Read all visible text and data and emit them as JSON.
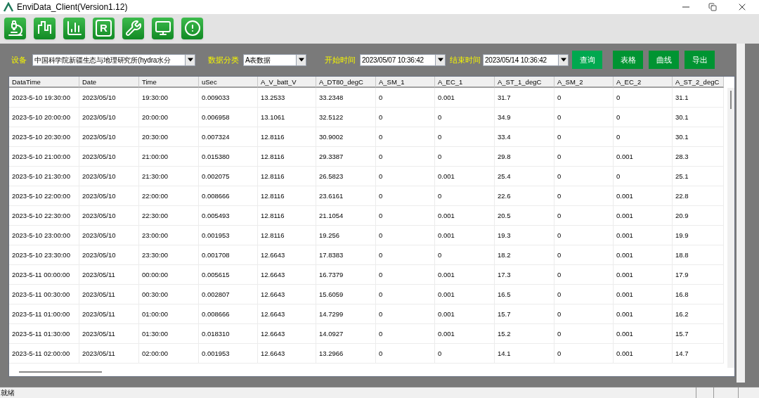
{
  "window": {
    "title": "EnviData_Client(Version1.12)"
  },
  "toolbar": [
    {
      "kind": "microscope"
    },
    {
      "kind": "step-line"
    },
    {
      "kind": "bars"
    },
    {
      "kind": "glyph",
      "glyph": "R"
    },
    {
      "kind": "tools"
    },
    {
      "kind": "monitor"
    },
    {
      "kind": "alert"
    }
  ],
  "filters": {
    "device_label": "设备",
    "device_value": "中国科学院新疆生态与地理研究所(hydra水分",
    "category_label": "数据分类",
    "category_value": "A表数据",
    "start_label": "开始时间",
    "start_value": "2023/05/07 10:36:42",
    "end_label": "结束时间",
    "end_value": "2023/05/14 10:36:42"
  },
  "buttons": [
    {
      "label": "查询",
      "selected": true
    },
    {
      "label": "表格",
      "selected": false
    },
    {
      "label": "曲线",
      "selected": false
    },
    {
      "label": "导出",
      "selected": false
    }
  ],
  "table": {
    "columns": [
      "DataTime",
      "Date",
      "Time",
      "uSec",
      "A_V_batt_V",
      "A_DT80_degC",
      "A_SM_1",
      "A_EC_1",
      "A_ST_1_degC",
      "A_SM_2",
      "A_EC_2",
      "A_ST_2_degC"
    ],
    "rows": [
      [
        "2023-5-10 19:30:00",
        "2023/05/10",
        "19:30:00",
        "0.009033",
        "13.2533",
        "33.2348",
        "0",
        "0.001",
        "31.7",
        "0",
        "0",
        "31.1"
      ],
      [
        "2023-5-10 20:00:00",
        "2023/05/10",
        "20:00:00",
        "0.006958",
        "13.1061",
        "32.5122",
        "0",
        "0",
        "34.9",
        "0",
        "0",
        "30.1"
      ],
      [
        "2023-5-10 20:30:00",
        "2023/05/10",
        "20:30:00",
        "0.007324",
        "12.8116",
        "30.9002",
        "0",
        "0",
        "33.4",
        "0",
        "0",
        "30.1"
      ],
      [
        "2023-5-10 21:00:00",
        "2023/05/10",
        "21:00:00",
        "0.015380",
        "12.8116",
        "29.3387",
        "0",
        "0",
        "29.8",
        "0",
        "0.001",
        "28.3"
      ],
      [
        "2023-5-10 21:30:00",
        "2023/05/10",
        "21:30:00",
        "0.002075",
        "12.8116",
        "26.5823",
        "0",
        "0.001",
        "25.4",
        "0",
        "0",
        "25.1"
      ],
      [
        "2023-5-10 22:00:00",
        "2023/05/10",
        "22:00:00",
        "0.008666",
        "12.8116",
        "23.6161",
        "0",
        "0",
        "22.6",
        "0",
        "0.001",
        "22.8"
      ],
      [
        "2023-5-10 22:30:00",
        "2023/05/10",
        "22:30:00",
        "0.005493",
        "12.8116",
        "21.1054",
        "0",
        "0.001",
        "20.5",
        "0",
        "0.001",
        "20.9"
      ],
      [
        "2023-5-10 23:00:00",
        "2023/05/10",
        "23:00:00",
        "0.001953",
        "12.8116",
        "19.256",
        "0",
        "0.001",
        "19.3",
        "0",
        "0.001",
        "19.9"
      ],
      [
        "2023-5-10 23:30:00",
        "2023/05/10",
        "23:30:00",
        "0.001708",
        "12.6643",
        "17.8383",
        "0",
        "0",
        "18.2",
        "0",
        "0.001",
        "18.8"
      ],
      [
        "2023-5-11 00:00:00",
        "2023/05/11",
        "00:00:00",
        "0.005615",
        "12.6643",
        "16.7379",
        "0",
        "0.001",
        "17.3",
        "0",
        "0.001",
        "17.9"
      ],
      [
        "2023-5-11 00:30:00",
        "2023/05/11",
        "00:30:00",
        "0.002807",
        "12.6643",
        "15.6059",
        "0",
        "0.001",
        "16.5",
        "0",
        "0.001",
        "16.8"
      ],
      [
        "2023-5-11 01:00:00",
        "2023/05/11",
        "01:00:00",
        "0.008666",
        "12.6643",
        "14.7299",
        "0",
        "0.001",
        "15.7",
        "0",
        "0.001",
        "16.2"
      ],
      [
        "2023-5-11 01:30:00",
        "2023/05/11",
        "01:30:00",
        "0.018310",
        "12.6643",
        "14.0927",
        "0",
        "0.001",
        "15.2",
        "0",
        "0.001",
        "15.7"
      ],
      [
        "2023-5-11 02:00:00",
        "2023/05/11",
        "02:00:00",
        "0.001953",
        "12.6643",
        "13.2966",
        "0",
        "0",
        "14.1",
        "0",
        "0.001",
        "14.7"
      ]
    ]
  },
  "status_bar": {
    "text": "就绪"
  }
}
